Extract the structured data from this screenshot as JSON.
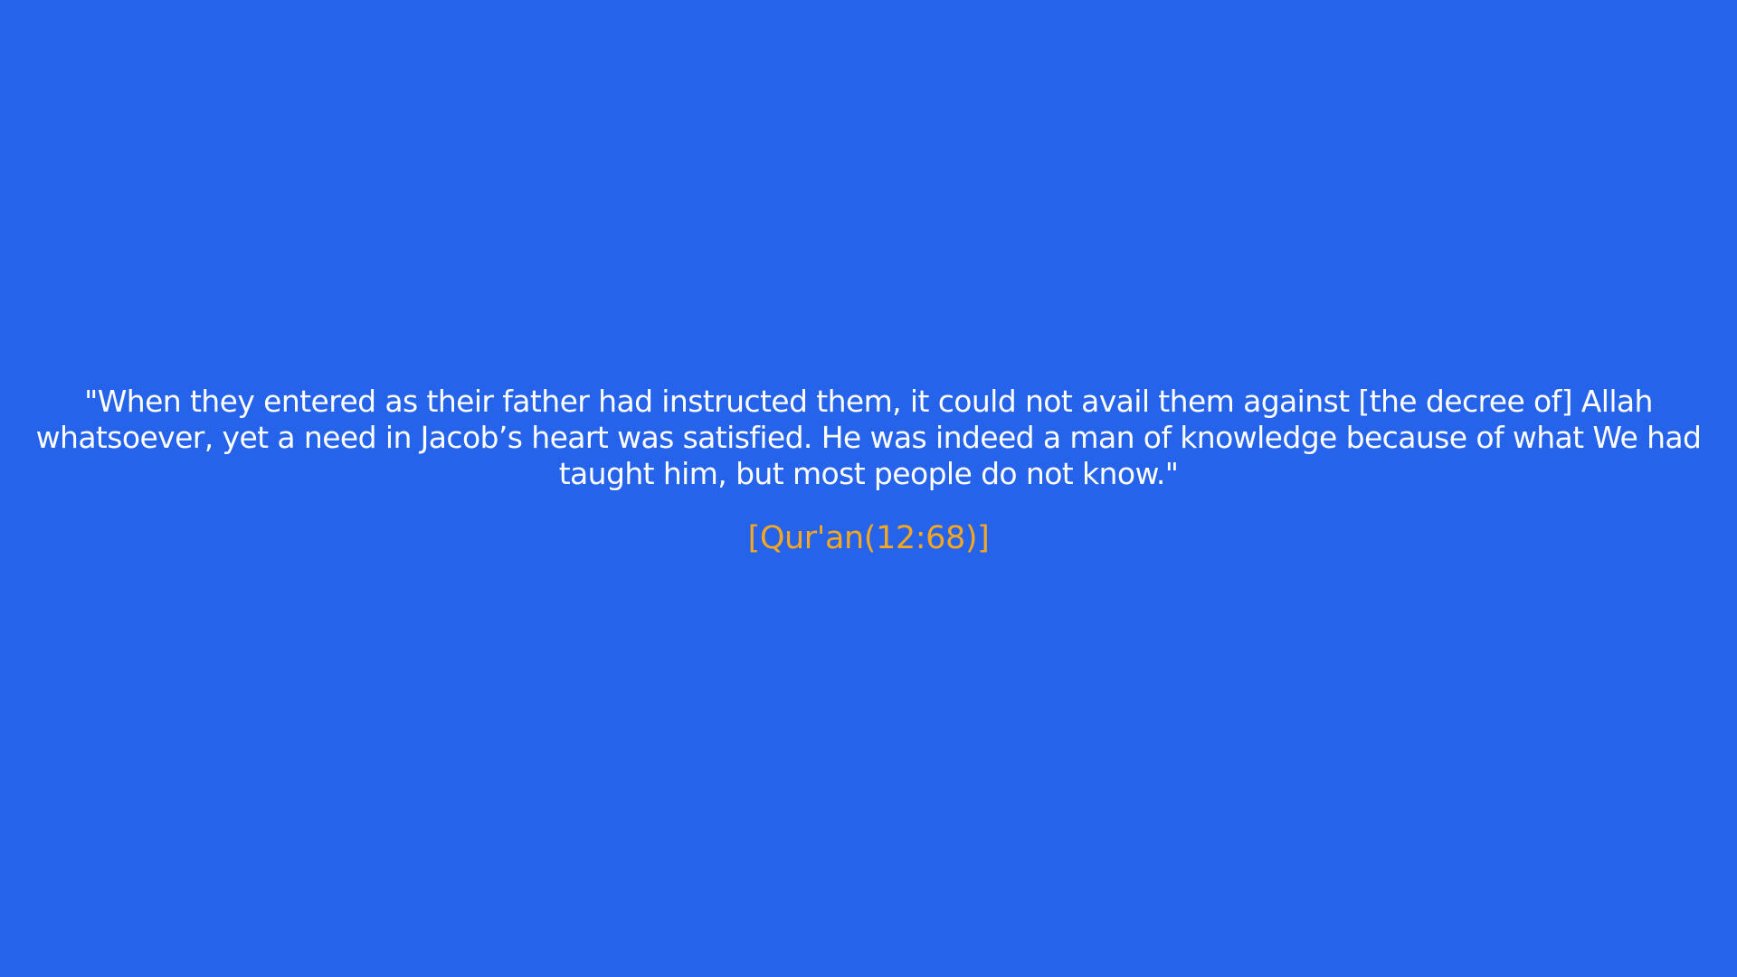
{
  "quote": {
    "text": "\"When they entered as their father had instructed them, it could not avail them against [the decree of] Allah whatsoever, yet a need in Jacob’s heart was satisfied. He was indeed a man of knowledge because of what We had taught him, but most people do not know.\"",
    "citation": "[Qur'an(12:68)]"
  },
  "colors": {
    "background": "#2563EB",
    "quote_text": "#FFFFFF",
    "citation_text": "#F5A623"
  }
}
